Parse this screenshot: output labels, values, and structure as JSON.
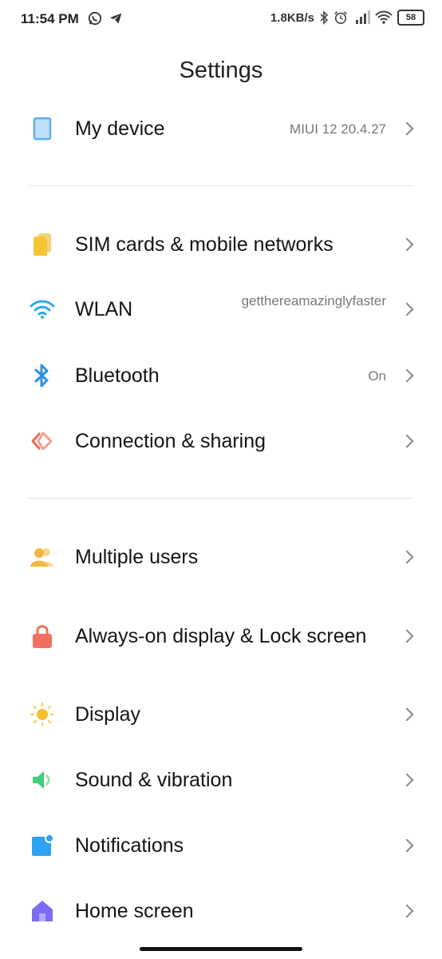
{
  "status_bar": {
    "time": "11:54 PM",
    "speed": "1.8KB/s",
    "battery": "58"
  },
  "title": "Settings",
  "items": [
    {
      "label": "My device",
      "value": "MIUI 12 20.4.27"
    },
    {
      "label": "SIM cards & mobile networks",
      "value": ""
    },
    {
      "label": "WLAN",
      "value": "getthereamazinglyfaster"
    },
    {
      "label": "Bluetooth",
      "value": "On"
    },
    {
      "label": "Connection & sharing",
      "value": ""
    },
    {
      "label": "Multiple users",
      "value": ""
    },
    {
      "label": "Always-on display & Lock screen",
      "value": ""
    },
    {
      "label": "Display",
      "value": ""
    },
    {
      "label": "Sound & vibration",
      "value": ""
    },
    {
      "label": "Notifications",
      "value": ""
    },
    {
      "label": "Home screen",
      "value": ""
    }
  ],
  "colors": {
    "device": "#5aaff0",
    "sim": "#f7c531",
    "wifi": "#2ea8f0",
    "bluetooth": "#2f8fe0",
    "sharing": "#ec6a4f",
    "users": "#f4b640",
    "lock": "#f2705f",
    "display": "#f5c02e",
    "sound": "#3fcf7a",
    "notifications": "#2ea1f2",
    "home": "#7b6cf2"
  }
}
